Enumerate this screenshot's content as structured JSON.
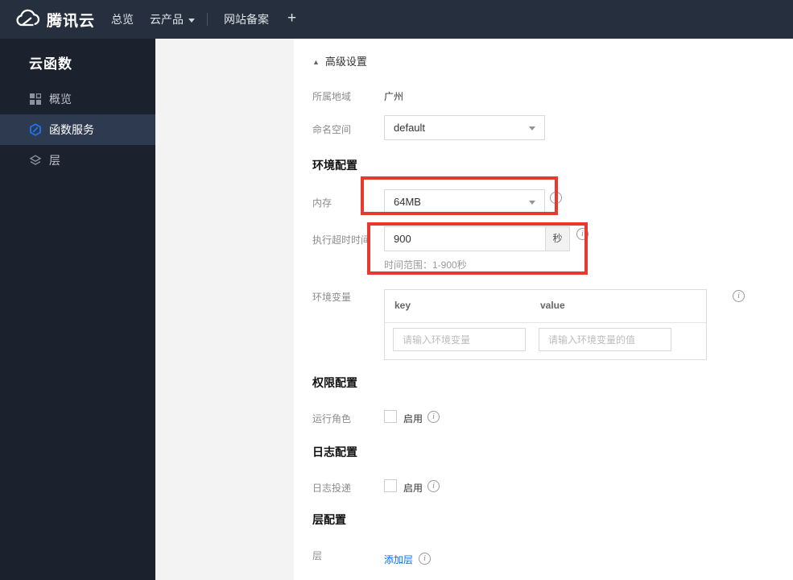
{
  "colors": {
    "topbar_bg": "#262f3d",
    "sidebar_bg": "#1b212d",
    "sidebar_active_bg": "#2e3a4f",
    "panel_bg": "#f3f3f3",
    "accent_blue": "#006eff",
    "annotation_red": "#e8392f"
  },
  "topbar": {
    "brand": "腾讯云",
    "overview": "总览",
    "products": "云产品",
    "beian": "网站备案",
    "plus": "+"
  },
  "sidebar": {
    "title": "云函数",
    "items": [
      {
        "label": "概览",
        "icon": "grid-icon"
      },
      {
        "label": "函数服务",
        "icon": "function-hexagon-icon"
      },
      {
        "label": "层",
        "icon": "layers-icon"
      }
    ]
  },
  "icons": {
    "info": "i",
    "collapse": "▲"
  },
  "main": {
    "advanced_toggle": "高级设置",
    "section_env": "环境配置",
    "section_perm": "权限配置",
    "section_log": "日志配置",
    "section_layer": "层配置",
    "region": {
      "label": "所属地域",
      "value": "广州"
    },
    "namespace": {
      "label": "命名空间",
      "value": "default"
    },
    "memory": {
      "label": "内存",
      "value": "64MB"
    },
    "timeout": {
      "label": "执行超时时间",
      "value": "900",
      "unit": "秒",
      "hint": "时间范围：1-900秒"
    },
    "env_vars": {
      "label": "环境变量",
      "key_header": "key",
      "value_header": "value",
      "key_placeholder": "请输入环境变量",
      "value_placeholder": "请输入环境变量的值"
    },
    "run_role": {
      "label": "运行角色",
      "enable": "启用"
    },
    "log_delivery": {
      "label": "日志投递",
      "enable": "启用"
    },
    "layer": {
      "label": "层",
      "add_link": "添加层"
    }
  }
}
